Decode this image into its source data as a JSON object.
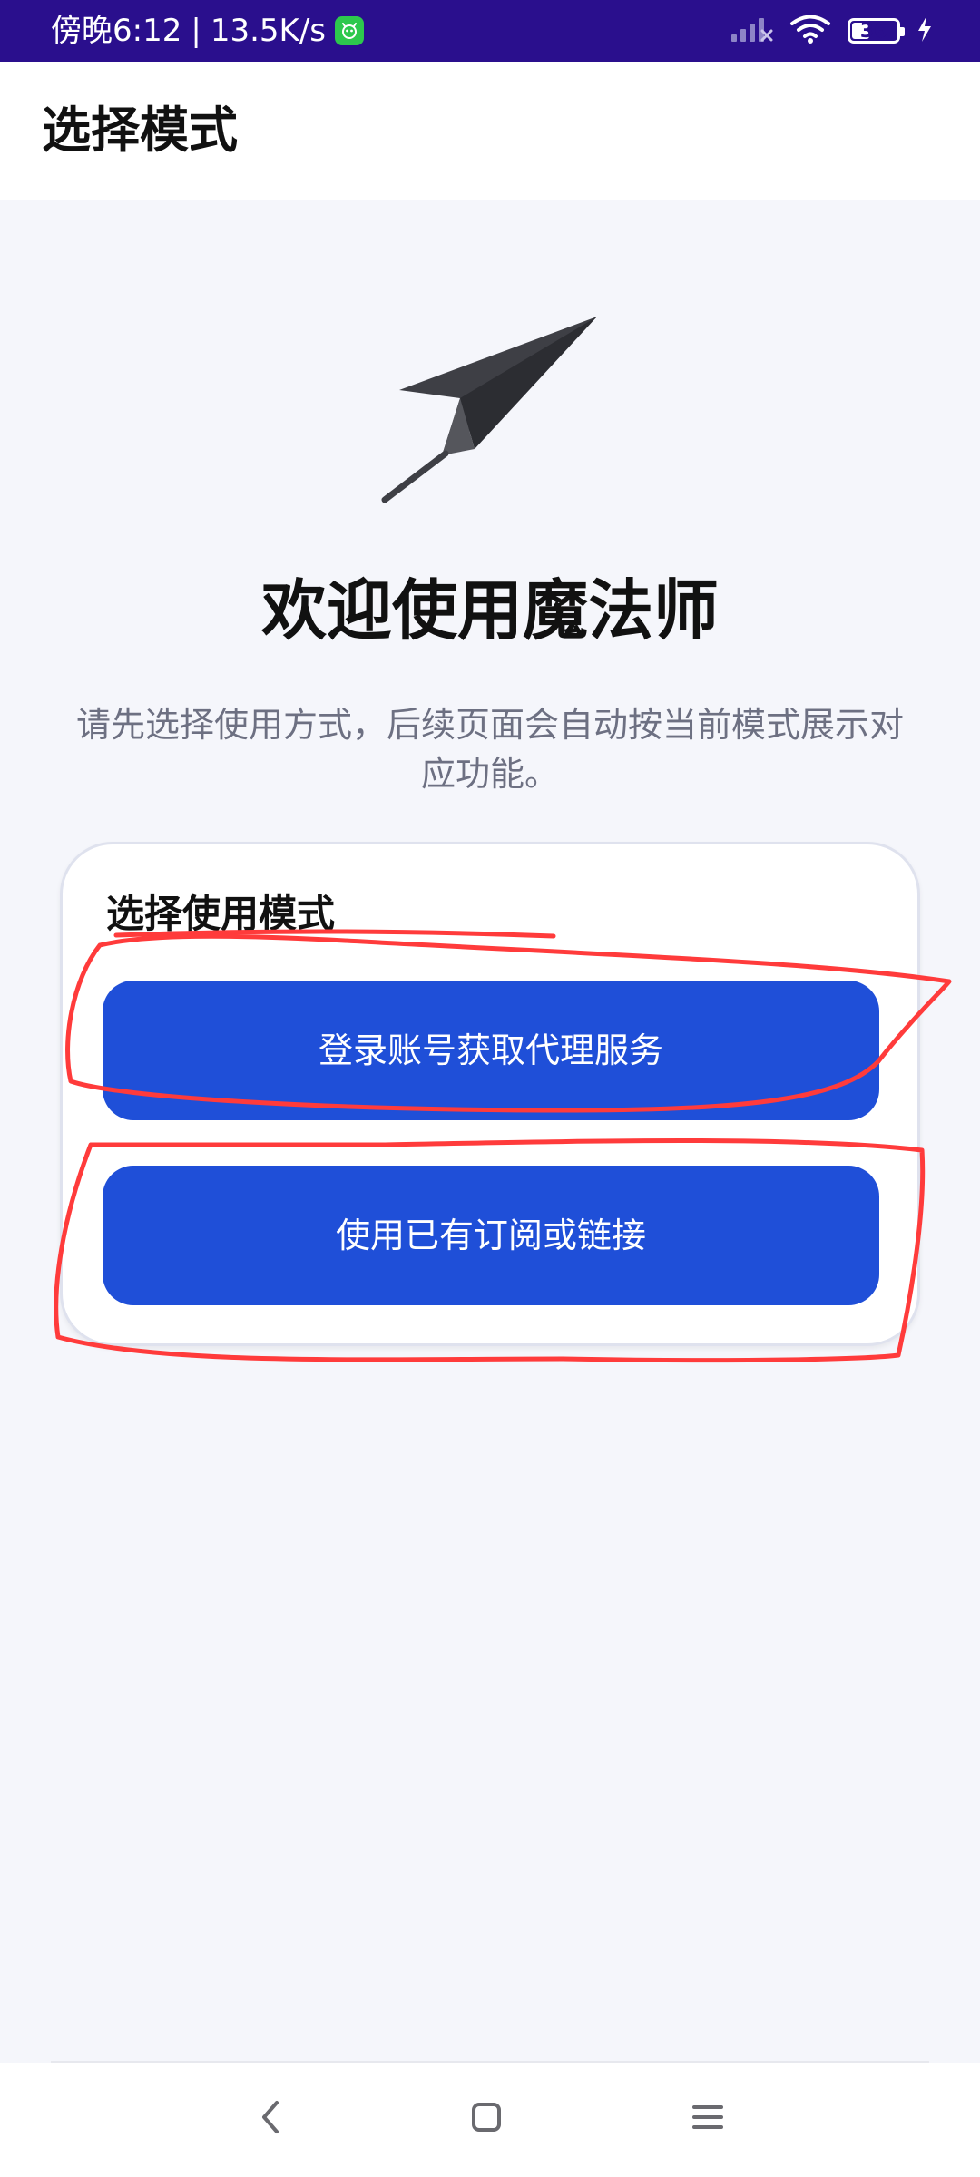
{
  "status_bar": {
    "time": "傍晚6:12",
    "separator": "|",
    "speed": "13.5K/s",
    "battery": "36",
    "battery_level": 0.36,
    "icons": [
      "app-notification-icon",
      "signal-icon",
      "wifi-icon",
      "battery-icon",
      "charging-icon"
    ]
  },
  "app_bar": {
    "title": "选择模式"
  },
  "hero": {
    "icon": "paper-plane-icon",
    "title": "欢迎使用魔法师",
    "description": "请先选择使用方式，后续页面会自动按当前模式展示对应功能。"
  },
  "mode_card": {
    "title": "选择使用模式",
    "buttons": [
      {
        "label": "登录账号获取代理服务"
      },
      {
        "label": "使用已有订阅或链接"
      }
    ]
  },
  "nav_bar": {
    "items": [
      "back-icon",
      "home-icon",
      "menu-icon"
    ]
  },
  "colors": {
    "status_bar": "#2a0f8d",
    "background": "#f5f6fb",
    "button": "#1f4fd8",
    "annotation": "#ff3b3b",
    "text_muted": "#6d7082"
  }
}
